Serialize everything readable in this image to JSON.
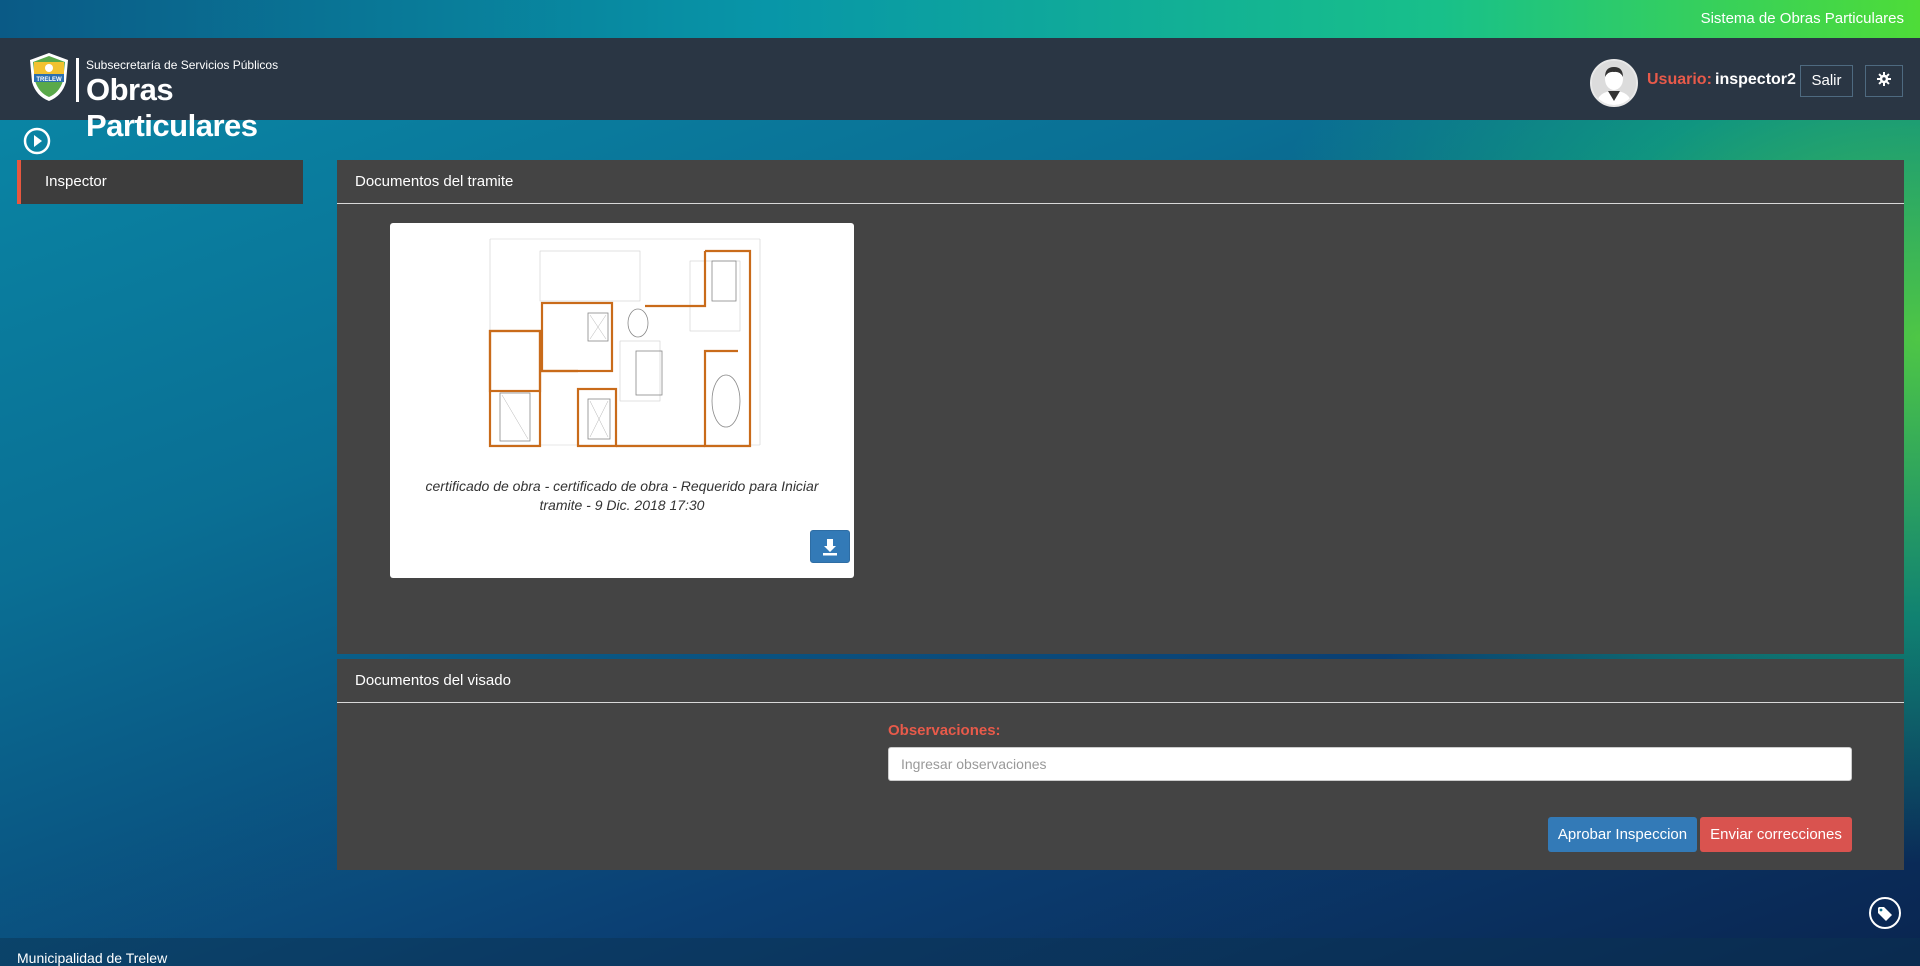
{
  "topbar": {
    "system_name": "Sistema de Obras Particulares"
  },
  "header": {
    "logo_subtitle": "Subsecretaría de Servicios Públicos",
    "logo_title": "Obras Particulares",
    "logo_crest_text": "TRELEW",
    "user_label": "Usuario:",
    "user_name": "inspector2",
    "logout_label": "Salir",
    "settings_icon": "gear-icon"
  },
  "sidebar": {
    "toggle_icon": "play-circle-icon",
    "items": [
      {
        "label": "Inspector",
        "active": true
      }
    ]
  },
  "panels": {
    "tramite": {
      "title": "Documentos del tramite",
      "documents": [
        {
          "caption": "certificado de obra - certificado de obra - Requerido para Iniciar tramite - 9 Dic. 2018 17:30",
          "download_icon": "download-icon"
        }
      ]
    },
    "visado": {
      "title": "Documentos del visado",
      "observations_label": "Observaciones:",
      "observations_placeholder": "Ingresar observaciones",
      "observations_value": "",
      "approve_label": "Aprobar Inspeccion",
      "send_label": "Enviar correcciones"
    }
  },
  "floating": {
    "tag_icon": "tag-icon"
  },
  "footer": {
    "text": "Municipalidad de Trelew"
  },
  "colors": {
    "header_bg": "#2a3644",
    "panel_bg": "#444444",
    "accent_red": "#e85a4a",
    "primary_blue": "#337ab7",
    "danger_red": "#d9534f"
  }
}
